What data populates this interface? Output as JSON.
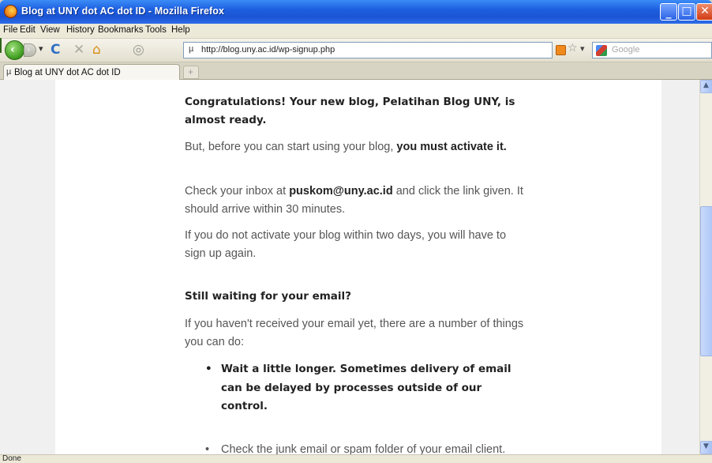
{
  "window": {
    "title": "Blog at UNY dot AC dot ID - Mozilla Firefox",
    "controls": {
      "minimize": "_",
      "maximize": "□",
      "close": "✕"
    }
  },
  "menubar": {
    "items": [
      "File",
      "Edit",
      "View",
      "History",
      "Bookmarks",
      "Tools",
      "Help"
    ]
  },
  "navbar": {
    "back_icon": "back-arrow-icon",
    "back_glyph": "‹",
    "forward_glyph": "›",
    "dropdown_glyph": "▾",
    "reload_glyph": "C",
    "stop_glyph": "✕",
    "home_glyph": "⌂",
    "history_glyph": "◎",
    "url": "http://blog.uny.ac.id/wp-signup.php",
    "url_favicon": "µ",
    "star_glyph": "☆",
    "search_placeholder": "Google"
  },
  "tabs": [
    {
      "label": "Blog at UNY dot AC dot ID",
      "favicon": "µ",
      "active": true
    }
  ],
  "newtab_glyph": "+",
  "content": {
    "congrats": "Congratulations! Your new blog, Pelatihan Blog UNY, is almost ready.",
    "activate_prefix": "But, before you can start using your blog, ",
    "activate_strong": "you must activate it.",
    "inbox_prefix": "Check your inbox at ",
    "inbox_email": "puskom@uny.ac.id",
    "inbox_suffix": " and click the link given. It should arrive within 30 minutes.",
    "twodays": "If you do not activate your blog within two days, you will have to sign up again.",
    "waiting_heading": "Still waiting for your email?",
    "number_things": "If you haven't received your email yet, there are a number of things you can do:",
    "bullets": [
      "Wait a little longer. Sometimes delivery of email can be delayed by processes outside of our control.",
      "Check the junk email or spam folder of your email client. Sometime emails wind up there by mistake."
    ],
    "bullet_glyph": "•"
  },
  "scrollbar": {
    "up_glyph": "▲",
    "down_glyph": "▼"
  },
  "status": {
    "text": "Done"
  },
  "colors": {
    "titlebar": "#1d5fe0",
    "chrome": "#ece9d8",
    "page_bg": "#ffffff"
  }
}
